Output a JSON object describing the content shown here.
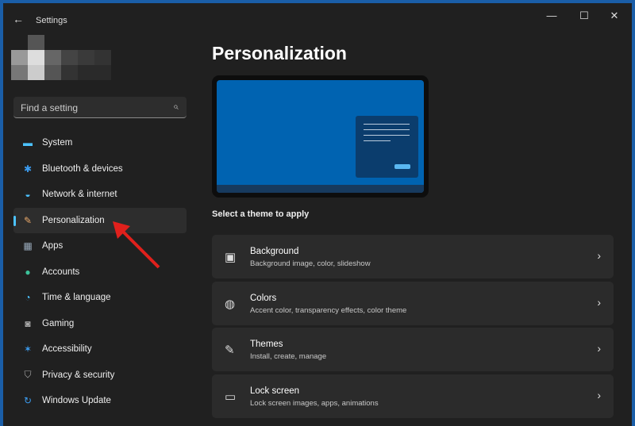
{
  "window": {
    "title": "Settings",
    "back": "←",
    "minimize": "—",
    "maximize": "☐",
    "close": "✕"
  },
  "search": {
    "placeholder": "Find a setting",
    "icon": "⌕"
  },
  "sidebar": {
    "items": [
      {
        "label": "System",
        "icon": "▬",
        "color": "#4cc2ff"
      },
      {
        "label": "Bluetooth & devices",
        "icon": "✱",
        "color": "#3b9cf0"
      },
      {
        "label": "Network & internet",
        "icon": "◒",
        "color": "#4cc2ff"
      },
      {
        "label": "Personalization",
        "icon": "✎",
        "color": "#e8a86a"
      },
      {
        "label": "Apps",
        "icon": "▦",
        "color": "#9ab"
      },
      {
        "label": "Accounts",
        "icon": "●",
        "color": "#3cc29a"
      },
      {
        "label": "Time & language",
        "icon": "◔",
        "color": "#4cc2ff"
      },
      {
        "label": "Gaming",
        "icon": "◙",
        "color": "#aaa"
      },
      {
        "label": "Accessibility",
        "icon": "✶",
        "color": "#3b9cf0"
      },
      {
        "label": "Privacy & security",
        "icon": "⛉",
        "color": "#aaa"
      },
      {
        "label": "Windows Update",
        "icon": "↻",
        "color": "#3b9cf0"
      }
    ],
    "selected": "Personalization"
  },
  "main": {
    "title": "Personalization",
    "theme_label": "Select a theme to apply",
    "cards": [
      {
        "title": "Background",
        "desc": "Background image, color, slideshow",
        "icon": "▣"
      },
      {
        "title": "Colors",
        "desc": "Accent color, transparency effects, color theme",
        "icon": "◍"
      },
      {
        "title": "Themes",
        "desc": "Install, create, manage",
        "icon": "✎"
      },
      {
        "title": "Lock screen",
        "desc": "Lock screen images, apps, animations",
        "icon": "▭"
      }
    ],
    "chevron": "›"
  }
}
